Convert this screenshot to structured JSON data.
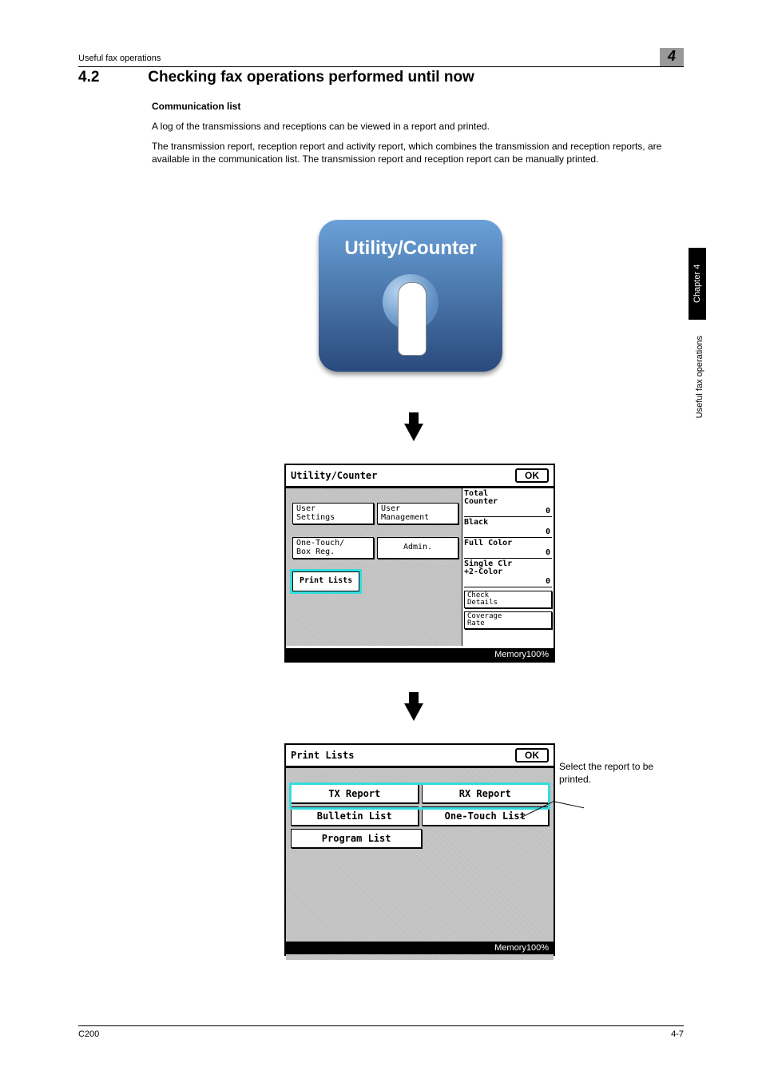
{
  "header": {
    "running_head": "Useful fax operations",
    "chapter_num": "4"
  },
  "section": {
    "number": "4.2",
    "title": "Checking fax operations performed until now"
  },
  "subhead": "Communication list",
  "para1": "A log of the transmissions and receptions can be viewed in a report and printed.",
  "para2": "The transmission report, reception report and activity report, which combines the transmission and reception reports, are available in the communication list. The transmission report and reception report can be manually printed.",
  "util_button_label": "Utility/Counter",
  "screen1": {
    "title": "Utility/Counter",
    "ok": "OK",
    "left_buttons": {
      "user_settings": "User\nSettings",
      "user_management": "User\nManagement",
      "one_touch": "One-Touch/\nBox Reg.",
      "admin": "Admin.",
      "print_lists": "Print Lists"
    },
    "counter": {
      "title": "Total\nCounter",
      "black_label": "Black",
      "black_value": "0",
      "full_color_label": "Full Color",
      "full_color_value": "0",
      "single_label": "Single Clr\n+2-Color",
      "single_value": "0",
      "check_details": "Check\nDetails",
      "coverage_rate": "Coverage\nRate"
    },
    "memory": "Memory100%"
  },
  "screen2": {
    "title": "Print Lists",
    "ok": "OK",
    "buttons": {
      "tx": "TX Report",
      "rx": "RX Report",
      "bulletin": "Bulletin List",
      "one_touch": "One-Touch List",
      "program": "Program List"
    },
    "memory": "Memory100%"
  },
  "callout": "Select the report to be printed.",
  "side": {
    "chapter": "Chapter 4",
    "title": "Useful fax operations"
  },
  "footer": {
    "model": "C200",
    "page": "4-7"
  }
}
